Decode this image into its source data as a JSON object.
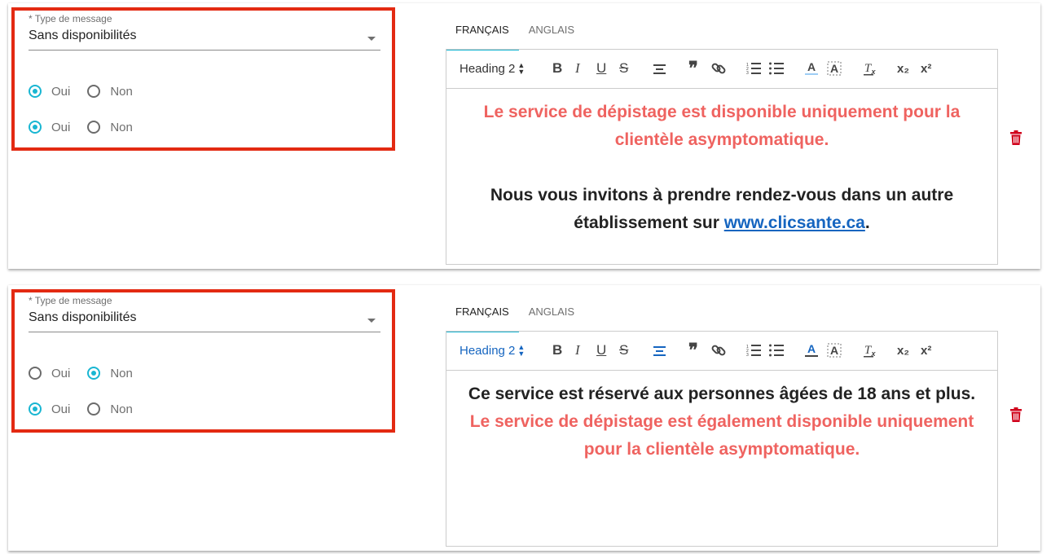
{
  "cards": [
    {
      "select": {
        "label": "* Type de message",
        "value": "Sans disponibilités"
      },
      "radio_rows": [
        {
          "options": [
            {
              "label": "Oui",
              "checked": true
            },
            {
              "label": "Non",
              "checked": false
            }
          ]
        },
        {
          "options": [
            {
              "label": "Oui",
              "checked": true
            },
            {
              "label": "Non",
              "checked": false
            }
          ]
        }
      ],
      "tabs": [
        {
          "label": "FRANÇAIS",
          "active": true
        },
        {
          "label": "ANGLAIS",
          "active": false
        }
      ],
      "toolbar": {
        "heading": "Heading 2",
        "heading_active": false,
        "align_center_active": false
      },
      "content": {
        "red_text": "Le service de dépistage est disponible uniquement pour la clientèle asymptomatique.",
        "dark_text_before": "Nous vous invitons à prendre rendez-vous dans un autre établissement sur",
        "link_text": "www.clicsante.ca",
        "dark_text_after": "."
      }
    },
    {
      "select": {
        "label": "* Type de message",
        "value": "Sans disponibilités"
      },
      "radio_rows": [
        {
          "options": [
            {
              "label": "Oui",
              "checked": false
            },
            {
              "label": "Non",
              "checked": true
            }
          ]
        },
        {
          "options": [
            {
              "label": "Oui",
              "checked": true
            },
            {
              "label": "Non",
              "checked": false
            }
          ]
        }
      ],
      "tabs": [
        {
          "label": "FRANÇAIS",
          "active": true
        },
        {
          "label": "ANGLAIS",
          "active": false
        }
      ],
      "toolbar": {
        "heading": "Heading 2",
        "heading_active": true,
        "align_center_active": true
      },
      "content": {
        "dark_text": "Ce service est réservé aux personnes âgées de 18 ans et plus.",
        "red_text": "Le service de dépistage est également disponible uniquement pour la clientèle asymptomatique."
      }
    }
  ],
  "icons": {
    "bold": "B",
    "italic": "I",
    "underline": "U",
    "strike": "S",
    "quote": "❞",
    "subscript": "x₂",
    "superscript": "x²",
    "clear_format": "T̸x"
  },
  "colors": {
    "accent": "#19b6d2",
    "highlight_border": "#e32a12",
    "red_text": "#ef6360",
    "link": "#1565c0",
    "trash": "#d0021b"
  }
}
